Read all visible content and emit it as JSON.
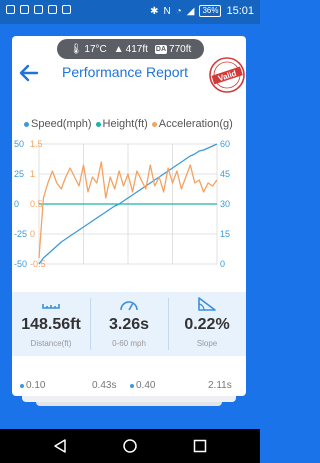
{
  "status_bar": {
    "battery": "36%",
    "time": "15:01"
  },
  "conditions": {
    "temperature": "17°C",
    "altitude": "417ft",
    "density_altitude_tag": "DA",
    "density_altitude": "770ft"
  },
  "header": {
    "title": "Performance Report"
  },
  "seal": {
    "text": "Valid"
  },
  "legend": {
    "speed": {
      "label": "Speed(mph)",
      "color": "#3d9ad8"
    },
    "height": {
      "label": "Height(ft)",
      "color": "#1cb3a8"
    },
    "acceleration": {
      "label": "Acceleration(g)",
      "color": "#f5a15f"
    }
  },
  "chart_data": {
    "type": "line",
    "x": [
      0,
      1,
      2,
      3,
      4,
      5,
      6,
      7,
      8,
      9,
      10,
      11,
      12,
      13,
      14,
      15,
      16,
      17,
      18,
      19,
      20,
      21,
      22,
      23,
      24,
      25,
      26,
      27,
      28,
      29,
      30,
      31,
      32,
      33,
      34,
      35,
      36,
      37,
      38,
      39,
      40
    ],
    "series": [
      {
        "name": "Speed(mph)",
        "axis": "right",
        "color": "#3d9ad8",
        "values": [
          0,
          3,
          5,
          7,
          9,
          11,
          12.5,
          14,
          15.5,
          17,
          18.5,
          20,
          21.5,
          23,
          24.5,
          26,
          27.5,
          29,
          30,
          31.5,
          33,
          34.5,
          36,
          37.5,
          39,
          40.5,
          42,
          43.5,
          45,
          46.5,
          48,
          49.5,
          51,
          52.5,
          54,
          55,
          56.5,
          57,
          58,
          59,
          60
        ]
      },
      {
        "name": "Height(ft)",
        "axis": "left",
        "color": "#1cb3a8",
        "values": [
          0.5,
          0.5,
          0.5,
          0.5,
          0.5,
          0.5,
          0.5,
          0.5,
          0.5,
          0.5,
          0.5,
          0.5,
          0.5,
          0.5,
          0.5,
          0.5,
          0.5,
          0.5,
          0.5,
          0.5,
          0.5,
          0.5,
          0.5,
          0.5,
          0.5,
          0.5,
          0.5,
          0.5,
          0.5,
          0.5,
          0.5,
          0.5,
          0.5,
          0.5,
          0.5,
          0.5,
          0.5,
          0.5,
          0.5,
          0.5,
          0.5
        ]
      },
      {
        "name": "Acceleration(g)",
        "axis": "left",
        "color": "#f5a15f",
        "values": [
          -0.4,
          0.6,
          0.85,
          1.05,
          0.85,
          0.75,
          0.95,
          1.1,
          0.95,
          0.8,
          1.15,
          0.7,
          0.95,
          0.85,
          1.2,
          0.6,
          0.95,
          0.75,
          1.05,
          0.8,
          1.0,
          0.7,
          1.05,
          0.9,
          0.75,
          1.15,
          0.8,
          0.95,
          0.7,
          1.1,
          0.85,
          1.05,
          0.75,
          0.95,
          1.15,
          0.85,
          0.9,
          0.7,
          0.85,
          0.8,
          0.9
        ]
      }
    ],
    "left_axis": {
      "primary_ticks": [
        "50",
        "25",
        "0",
        "-25",
        "-50"
      ],
      "secondary_ticks": [
        "1.5",
        "1",
        "0.5",
        "0",
        "-0.5"
      ],
      "primary_range": [
        -50,
        50
      ],
      "secondary_range": [
        -0.5,
        1.5
      ]
    },
    "right_axis": {
      "ticks": [
        "60",
        "45",
        "30",
        "15",
        "0"
      ],
      "range": [
        0,
        60
      ]
    },
    "grid": true
  },
  "stats": [
    {
      "value": "148.56ft",
      "label": "Distance(ft)",
      "icon": "distance-icon"
    },
    {
      "value": "3.26s",
      "label": "0-60 mph",
      "icon": "speedometer-icon"
    },
    {
      "value": "0.22%",
      "label": "Slope",
      "icon": "slope-icon"
    }
  ],
  "partial_row": [
    "0.10",
    "0.43s",
    "0.40",
    "2.11s"
  ]
}
